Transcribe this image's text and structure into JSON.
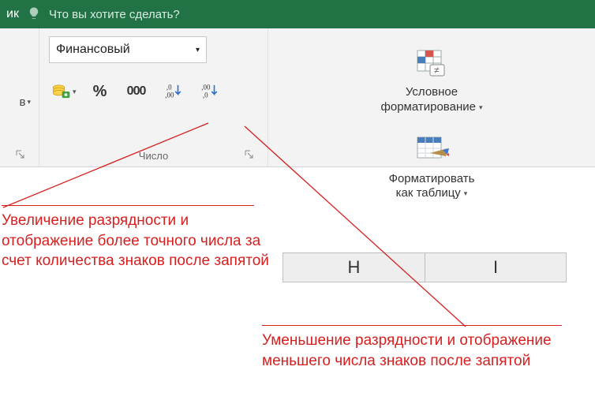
{
  "titlebar": {
    "trailing_tab_fragment": "ик",
    "tell_me_placeholder": "Что вы хотите сделать?"
  },
  "number_group": {
    "label": "Число",
    "format_combo_value": "Финансовый",
    "accounting_btn": "Финансовый числовой формат",
    "percent_btn": "%",
    "comma_btn": "000",
    "increase_decimal_btn": "Увеличить разрядность",
    "decrease_decimal_btn": "Уменьшить разрядность"
  },
  "styles_group": {
    "conditional_formatting_line1": "Условное",
    "conditional_formatting_line2": "форматирование",
    "format_as_table_line1": "Форматировать",
    "format_as_table_line2": "как таблицу"
  },
  "columns": {
    "h": "H",
    "i": "I"
  },
  "annotations": {
    "increase": "Увеличение разрядности и отображение более точного числа за счет количества знаков после запятой",
    "decrease": "Уменьшение разрядности и отображение меньшего числа знаков после запятой"
  }
}
